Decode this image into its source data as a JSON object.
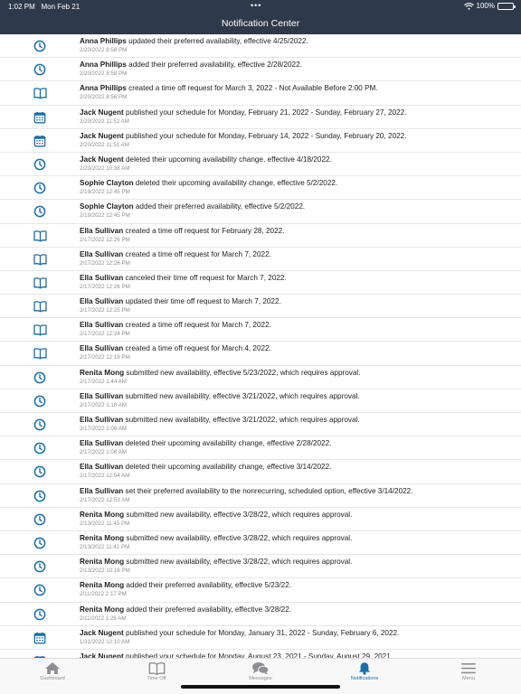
{
  "status_bar": {
    "time": "1:02 PM",
    "date": "Mon Feb 21",
    "battery": "100%",
    "battery_level": 1.0
  },
  "header": {
    "title": "Notification Center"
  },
  "colors": {
    "header_bg": "#2e3a49",
    "icon": "#1b6fa8",
    "active_tab": "#1b6fa8",
    "inactive_tab": "#8e8e93"
  },
  "notifications": [
    {
      "icon": "clock-icon",
      "name": "Anna Phillips",
      "text": " updated their preferred availability, effective 4/25/2022.",
      "time": "2/20/2022 8:58 PM"
    },
    {
      "icon": "clock-icon",
      "name": "Anna Phillips",
      "text": " added their preferred availability, effective 2/28/2022.",
      "time": "2/20/2022 8:58 PM"
    },
    {
      "icon": "book-icon",
      "name": "Anna Phillips",
      "text": " created a time off request for March 3, 2022 - Not Available Before 2:00 PM.",
      "time": "2/20/2022 8:56 PM"
    },
    {
      "icon": "calendar-icon",
      "name": "Jack Nugent",
      "text": " published your schedule for Monday, February 21, 2022 - Sunday, February 27, 2022.",
      "time": "2/20/2022 11:52 AM"
    },
    {
      "icon": "calendar-icon",
      "name": "Jack Nugent",
      "text": " published your schedule for Monday, February 14, 2022 - Sunday, February 20, 2022.",
      "time": "2/20/2022 11:51 AM"
    },
    {
      "icon": "clock-icon",
      "name": "Jack Nugent",
      "text": " deleted their upcoming availability change, effective 4/18/2022.",
      "time": "2/20/2022 10:38 AM"
    },
    {
      "icon": "clock-icon",
      "name": "Sophie Clayton",
      "text": " deleted their upcoming availability change, effective 5/2/2022.",
      "time": "2/19/2022 12:45 PM"
    },
    {
      "icon": "clock-icon",
      "name": "Sophie Clayton",
      "text": " added their preferred availability, effective 5/2/2022.",
      "time": "2/19/2022 12:45 PM"
    },
    {
      "icon": "book-icon",
      "name": "Ella Sullivan",
      "text": " created a time off request for February 28, 2022.",
      "time": "2/17/2022 12:26 PM"
    },
    {
      "icon": "book-icon",
      "name": "Ella Sullivan",
      "text": " created a time off request for March 7, 2022.",
      "time": "2/17/2022 12:26 PM"
    },
    {
      "icon": "book-icon",
      "name": "Ella Sullivan",
      "text": " canceled their time off request for March 7, 2022.",
      "time": "2/17/2022 12:26 PM"
    },
    {
      "icon": "book-icon",
      "name": "Ella Sullivan",
      "text": " updated their time off request to March 7, 2022.",
      "time": "2/17/2022 12:25 PM"
    },
    {
      "icon": "book-icon",
      "name": "Ella Sullivan",
      "text": " created a time off request for March 7, 2022.",
      "time": "2/17/2022 12:24 PM"
    },
    {
      "icon": "book-icon",
      "name": "Ella Sullivan",
      "text": " created a time off request for March 4, 2022.",
      "time": "2/17/2022 12:19 PM"
    },
    {
      "icon": "clock-icon",
      "name": "Renita Mong",
      "text": " submitted new availability, effective 5/23/2022, which requires approval.",
      "time": "2/17/2022 1:44 AM"
    },
    {
      "icon": "clock-icon",
      "name": "Ella Sullivan",
      "text": " submitted new availability, effective 3/21/2022, which requires approval.",
      "time": "2/17/2022 1:18 AM"
    },
    {
      "icon": "clock-icon",
      "name": "Ella Sullivan",
      "text": " submitted new availability, effective 3/21/2022, which requires approval.",
      "time": "2/17/2022 1:08 AM"
    },
    {
      "icon": "clock-icon",
      "name": "Ella Sullivan",
      "text": " deleted their upcoming availability change, effective 2/28/2022.",
      "time": "2/17/2022 1:08 AM"
    },
    {
      "icon": "clock-icon",
      "name": "Ella Sullivan",
      "text": " deleted their upcoming availability change, effective 3/14/2022.",
      "time": "2/17/2022 12:54 AM"
    },
    {
      "icon": "clock-icon",
      "name": "Ella Sullivan",
      "text": " set their preferred availability to the nonrecurring, scheduled option, effective 3/14/2022.",
      "time": "2/17/2022 12:53 AM"
    },
    {
      "icon": "clock-icon",
      "name": "Renita Mong",
      "text": " submitted new availability, effective 3/28/22, which requires approval.",
      "time": "2/13/2022 11:45 PM"
    },
    {
      "icon": "clock-icon",
      "name": "Renita Mong",
      "text": " submitted new availability, effective 3/28/22, which requires approval.",
      "time": "2/13/2022 11:41 PM"
    },
    {
      "icon": "clock-icon",
      "name": "Renita Mong",
      "text": " submitted new availability, effective 3/28/22, which requires approval.",
      "time": "2/13/2022 10:16 PM"
    },
    {
      "icon": "clock-icon",
      "name": "Renita Mong",
      "text": " added their preferred availability, effective 5/23/22.",
      "time": "2/11/2022 2:17 PM"
    },
    {
      "icon": "clock-icon",
      "name": "Renita Mong",
      "text": " added their preferred availability, effective 3/28/22.",
      "time": "2/11/2022 1:26 AM"
    },
    {
      "icon": "calendar-icon",
      "name": "Jack Nugent",
      "text": " published your schedule for Monday, January 31, 2022 - Sunday, February 6, 2022.",
      "time": "1/31/2022 12:10 AM"
    },
    {
      "icon": "calendar-icon",
      "name": "Jack Nugent",
      "text": " published your schedule for Monday, August 23, 2021 - Sunday, August 29, 2021.",
      "time": ""
    }
  ],
  "tabs": [
    {
      "label": "Dashboard",
      "icon": "home-icon",
      "active": false
    },
    {
      "label": "Time Off",
      "icon": "book-icon",
      "active": false
    },
    {
      "label": "Messages",
      "icon": "chat-bubbles-icon",
      "active": false
    },
    {
      "label": "Notifications",
      "icon": "bell-icon",
      "active": true
    },
    {
      "label": "Menu",
      "icon": "hamburger-menu-icon",
      "active": false
    }
  ]
}
